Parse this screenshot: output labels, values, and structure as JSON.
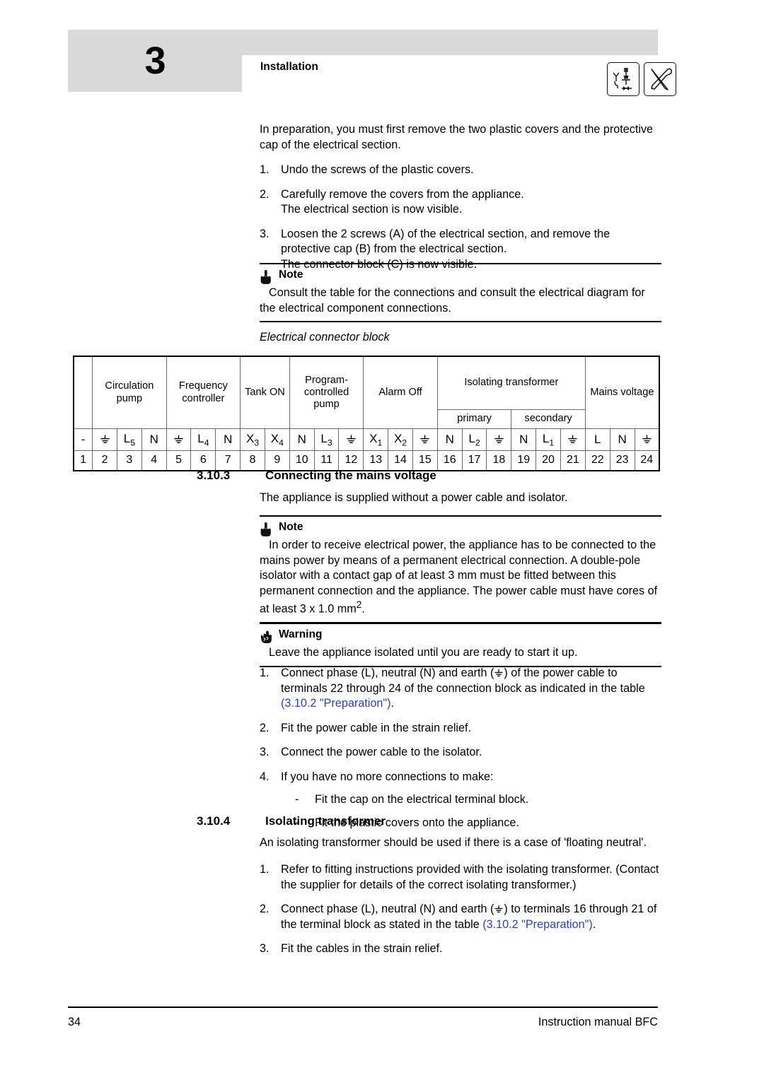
{
  "header": {
    "chapter_number": "3",
    "title": "Installation",
    "icons": [
      "piping-valve-diagram-icon",
      "crossed-tools-icon"
    ]
  },
  "intro": {
    "paragraph": "In preparation, you must first remove the two plastic covers and the protective cap of the electrical section.",
    "steps": [
      {
        "marker": "1.",
        "text": "Undo the screws of the plastic covers."
      },
      {
        "marker": "2.",
        "text": "Carefully remove the covers from the appliance.\nThe electrical section is now visible."
      },
      {
        "marker": "3.",
        "text": "Loosen the 2 screws (A) of the electrical section, and remove the protective cap (B) from the electrical section.\nThe connector block (C) is now visible."
      }
    ]
  },
  "note1": {
    "title": "Note",
    "icon": "pointing-hand-icon",
    "body": "Consult the table for the connections and consult the electrical diagram for the electrical component connections."
  },
  "table_caption": "Electrical connector block",
  "connector_table": {
    "groups": [
      {
        "label": "",
        "span": 1
      },
      {
        "label": "Circulation pump",
        "span": 3
      },
      {
        "label": "Frequency controller",
        "span": 3
      },
      {
        "label": "Tank ON",
        "span": 2
      },
      {
        "label": "Program-controlled pump",
        "span": 3
      },
      {
        "label": "Alarm Off",
        "span": 3
      },
      {
        "label": "Isolating transformer",
        "span": 6
      },
      {
        "label": "Mains voltage",
        "span": 3
      }
    ],
    "subgroups": [
      {
        "label": "primary",
        "span": 3,
        "under": "Isolating transformer"
      },
      {
        "label": "secondary",
        "span": 3,
        "under": "Isolating transformer"
      }
    ],
    "symbols": [
      "-",
      "earth",
      "L5",
      "N",
      "earth",
      "L4",
      "N",
      "X3",
      "X4",
      "N",
      "L3",
      "earth",
      "X1",
      "X2",
      "earth",
      "N",
      "L2",
      "earth",
      "N",
      "L1",
      "earth",
      "L",
      "N",
      "earth"
    ],
    "numbers": [
      "1",
      "2",
      "3",
      "4",
      "5",
      "6",
      "7",
      "8",
      "9",
      "10",
      "11",
      "12",
      "13",
      "14",
      "15",
      "16",
      "17",
      "18",
      "19",
      "20",
      "21",
      "22",
      "23",
      "24"
    ]
  },
  "section_3_10_3": {
    "number": "3.10.3",
    "title": "Connecting the mains voltage",
    "intro": "The appliance is supplied without a power cable and isolator."
  },
  "note2": {
    "title": "Note",
    "icon": "pointing-hand-icon",
    "body_part1": "In order to receive electrical power, the appliance has to be connected to the mains power by means of a permanent electrical connection. A double-pole isolator with a contact gap of at least 3 mm must be fitted between this permanent connection and the appliance. The power cable must have cores of at least 3 x 1.0 mm",
    "body_superscript": "2",
    "body_part2": "."
  },
  "warning1": {
    "title": "Warning",
    "icon": "warning-hand-icon",
    "body": "Leave the appliance isolated until you are ready to start it up."
  },
  "mains_steps": {
    "step1_pre": "Connect phase (L), neutral (N) and earth (",
    "step1_mid": ") of the power cable to terminals 22 through 24 of the connection block as indicated in the table ",
    "step1_link": "(3.10.2 \"Preparation\")",
    "step1_post": ".",
    "step1_marker": "1.",
    "items": [
      {
        "marker": "2.",
        "text": "Fit the power cable in the strain relief."
      },
      {
        "marker": "3.",
        "text": "Connect the power cable to the isolator."
      },
      {
        "marker": "4.",
        "text": "If you have no more connections to make:"
      }
    ],
    "subitems": [
      {
        "marker": "-",
        "text": "Fit the cap on the electrical terminal block."
      },
      {
        "marker": "-",
        "text": "Fit the plastic covers onto the appliance."
      }
    ]
  },
  "section_3_10_4": {
    "number": "3.10.4",
    "title": "Isolating transformer",
    "intro": "An isolating transformer should be used if there is a case of 'floating neutral'.",
    "steps": [
      {
        "marker": "1.",
        "text": "Refer to fitting instructions provided with the isolating transformer. (Contact the supplier for details of the correct isolating transformer.)"
      }
    ],
    "step2_marker": "2.",
    "step2_pre": "Connect phase (L), neutral (N) and earth (",
    "step2_mid": ") to terminals 16 through 21 of the terminal block as stated in the table ",
    "step2_link": "(3.10.2 \"Preparation\")",
    "step2_post": ".",
    "step3_marker": "3.",
    "step3_text": "Fit the cables in the strain relief."
  },
  "footer": {
    "page_number": "34",
    "manual_title": "Instruction manual BFC"
  },
  "colors": {
    "band_gray": "#d9d9d9",
    "link_blue": "#2b3ed4",
    "rule_black": "#000000"
  }
}
